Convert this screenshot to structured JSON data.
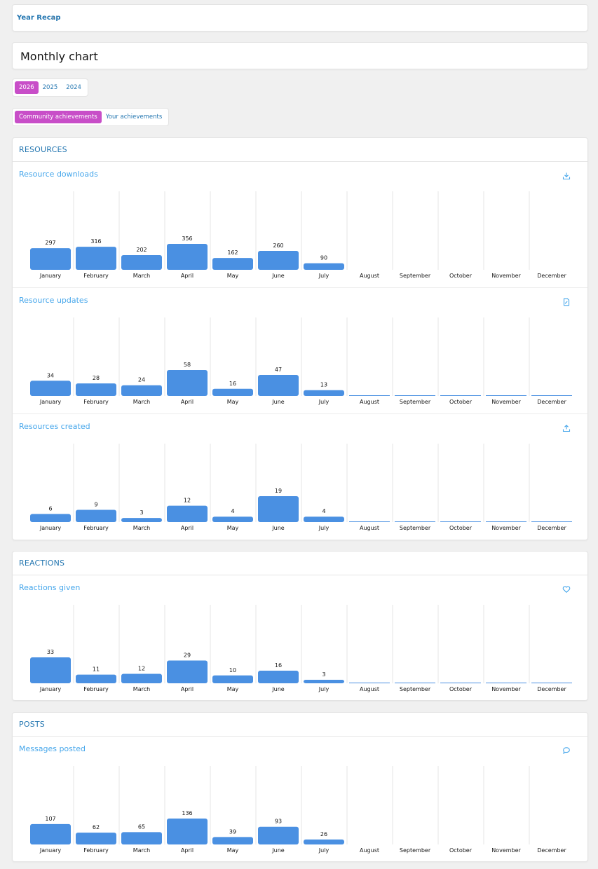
{
  "breadcrumb": {
    "label": "Year Recap",
    "chevron": "›"
  },
  "page_title": "Monthly chart",
  "years": [
    {
      "label": "2026",
      "active": true
    },
    {
      "label": "2025",
      "active": false
    },
    {
      "label": "2024",
      "active": false
    }
  ],
  "scopes": [
    {
      "label": "Community achievements",
      "active": true
    },
    {
      "label": "Your achievements",
      "active": false
    }
  ],
  "colors": {
    "accent": "#c84ec8",
    "bar": "#4a90e2",
    "link": "#2577b1",
    "subtitle": "#47a7eb"
  },
  "sections": {
    "resources": {
      "title": "RESOURCES"
    },
    "reactions": {
      "title": "REACTIONS"
    },
    "posts": {
      "title": "POSTS"
    }
  },
  "chart_data": [
    {
      "type": "bar",
      "title": "Resource downloads",
      "icon": "download-icon",
      "categories": [
        "January",
        "February",
        "March",
        "April",
        "May",
        "June",
        "July",
        "August",
        "September",
        "October",
        "November",
        "December"
      ],
      "values": [
        297,
        316,
        202,
        356,
        162,
        260,
        90,
        null,
        null,
        null,
        null,
        null
      ]
    },
    {
      "type": "bar",
      "title": "Resource updates",
      "icon": "document-edit-icon",
      "categories": [
        "January",
        "February",
        "March",
        "April",
        "May",
        "June",
        "July",
        "August",
        "September",
        "October",
        "November",
        "December"
      ],
      "values": [
        34,
        28,
        24,
        58,
        16,
        47,
        13,
        0,
        0,
        0,
        0,
        0
      ]
    },
    {
      "type": "bar",
      "title": "Resources created",
      "icon": "upload-icon",
      "categories": [
        "January",
        "February",
        "March",
        "April",
        "May",
        "June",
        "July",
        "August",
        "September",
        "October",
        "November",
        "December"
      ],
      "values": [
        6,
        9,
        3,
        12,
        4,
        19,
        4,
        0,
        0,
        0,
        0,
        0
      ]
    },
    {
      "type": "bar",
      "title": "Reactions given",
      "icon": "heart-icon",
      "categories": [
        "January",
        "February",
        "March",
        "April",
        "May",
        "June",
        "July",
        "August",
        "September",
        "October",
        "November",
        "December"
      ],
      "values": [
        33,
        11,
        12,
        29,
        10,
        16,
        3,
        0,
        0,
        0,
        0,
        0
      ]
    },
    {
      "type": "bar",
      "title": "Messages posted",
      "icon": "comment-icon",
      "categories": [
        "January",
        "February",
        "March",
        "April",
        "May",
        "June",
        "July",
        "August",
        "September",
        "October",
        "November",
        "December"
      ],
      "values": [
        107,
        62,
        65,
        136,
        39,
        93,
        26,
        null,
        null,
        null,
        null,
        null
      ]
    }
  ]
}
